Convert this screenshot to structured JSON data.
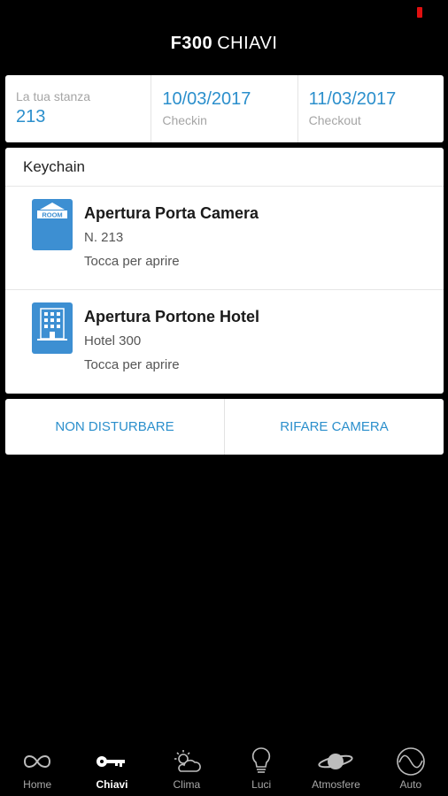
{
  "header": {
    "brand": "F300",
    "section": "CHIAVI"
  },
  "room_info": {
    "room": {
      "caption": "La tua stanza",
      "value": "213"
    },
    "checkin": {
      "value": "10/03/2017",
      "caption": "Checkin"
    },
    "checkout": {
      "value": "11/03/2017",
      "caption": "Checkout"
    }
  },
  "keychain": {
    "title": "Keychain",
    "items": [
      {
        "icon": "room-key-icon",
        "icon_text": "ROOM",
        "title": "Apertura Porta Camera",
        "sub": "N. 213",
        "hint": "Tocca per aprire"
      },
      {
        "icon": "hotel-building-icon",
        "title": "Apertura Portone Hotel",
        "sub": "Hotel 300",
        "hint": "Tocca per aprire"
      }
    ]
  },
  "actions": {
    "do_not_disturb": "NON DISTURBARE",
    "make_room": "RIFARE CAMERA"
  },
  "tabs": [
    {
      "label": "Home",
      "icon": "infinity-icon",
      "active": false
    },
    {
      "label": "Chiavi",
      "icon": "key-icon",
      "active": true
    },
    {
      "label": "Clima",
      "icon": "sun-cloud-icon",
      "active": false
    },
    {
      "label": "Luci",
      "icon": "lightbulb-icon",
      "active": false
    },
    {
      "label": "Atmosfere",
      "icon": "planet-icon",
      "active": false
    },
    {
      "label": "Auto",
      "icon": "wave-circle-icon",
      "active": false
    }
  ],
  "colors": {
    "accent": "#2b8fcc",
    "icon_bg": "#3d8fd2",
    "background": "#000000"
  }
}
